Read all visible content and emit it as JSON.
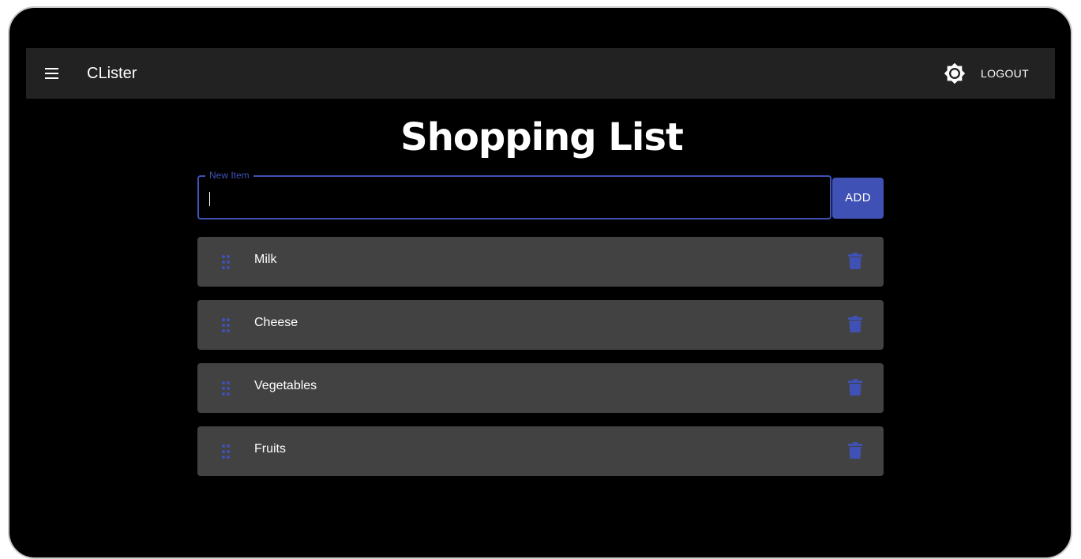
{
  "header": {
    "menu_icon": "hamburger-menu-icon",
    "app_title": "CLister",
    "theme_icon": "brightness-icon",
    "logout_label": "LOGOUT"
  },
  "main": {
    "title": "Shopping List",
    "new_item": {
      "label": "New Item",
      "value": "",
      "placeholder": ""
    },
    "add_label": "ADD",
    "items": [
      {
        "label": "Milk"
      },
      {
        "label": "Cheese"
      },
      {
        "label": "Vegetables"
      },
      {
        "label": "Fruits"
      }
    ],
    "item_icons": {
      "drag": "drag-handle-icon",
      "delete": "trash-icon"
    }
  },
  "colors": {
    "accent": "#3f51b5",
    "background": "#000000",
    "appbar": "#222222",
    "card": "#424242",
    "text": "#ffffff"
  }
}
